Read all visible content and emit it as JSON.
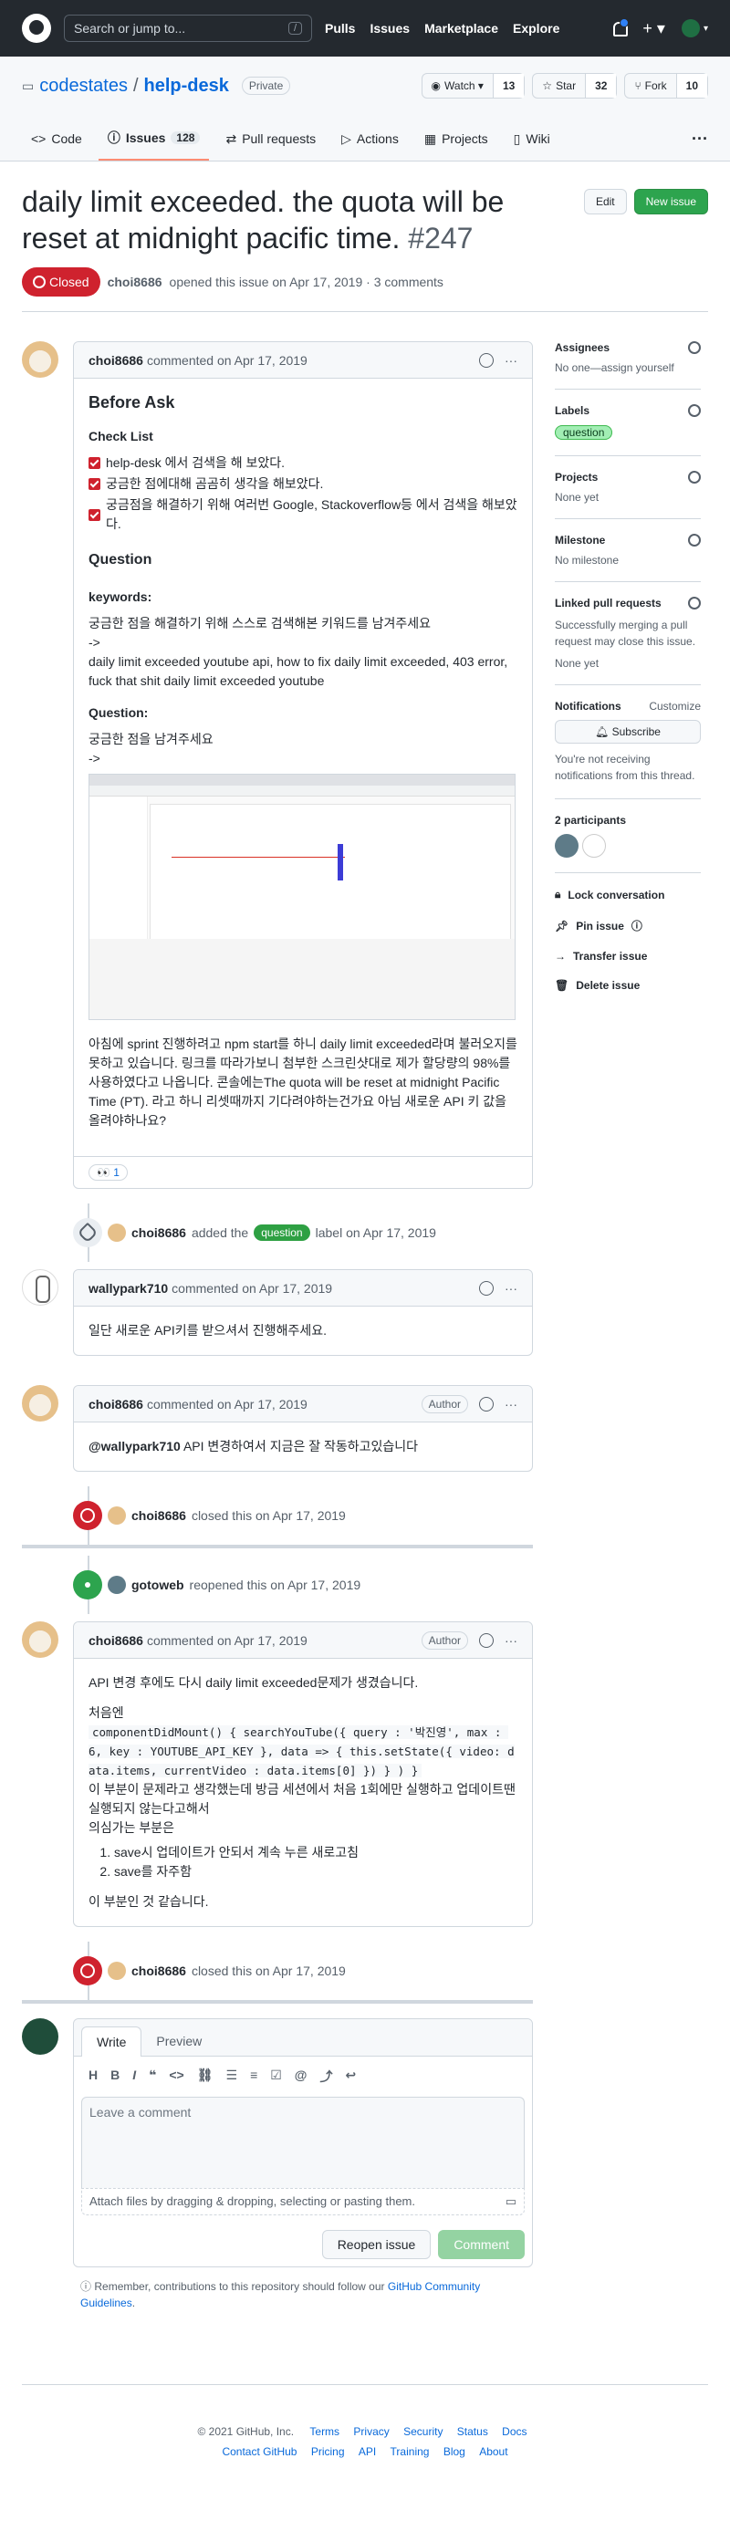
{
  "header": {
    "search_placeholder": "Search or jump to...",
    "search_key": "/",
    "nav": [
      "Pulls",
      "Issues",
      "Marketplace",
      "Explore"
    ]
  },
  "repo": {
    "owner": "codestates",
    "name": "help-desk",
    "visibility": "Private",
    "watch_label": "Watch",
    "watch_count": "13",
    "star_label": "Star",
    "star_count": "32",
    "fork_label": "Fork",
    "fork_count": "10"
  },
  "tabs": [
    {
      "label": "Code"
    },
    {
      "label": "Issues",
      "count": "128"
    },
    {
      "label": "Pull requests"
    },
    {
      "label": "Actions"
    },
    {
      "label": "Projects"
    },
    {
      "label": "Wiki"
    }
  ],
  "issue": {
    "title": "daily limit exceeded. the quota will be reset at midnight pacific time.",
    "number": "#247",
    "edit": "Edit",
    "new_issue": "New issue",
    "state": "Closed",
    "author": "choi8686",
    "meta": "opened this issue on Apr 17, 2019 · 3 comments"
  },
  "c1": {
    "author": "choi8686",
    "meta": "commented on Apr 17, 2019",
    "h_before": "Before Ask",
    "h_check": "Check List",
    "checks": [
      "help-desk 에서 검색을 해 보았다.",
      "궁금한 점에대해 곰곰히 생각을 해보았다.",
      "궁금점을 해결하기 위해 여러번 Google, Stackoverflow등 에서 검색을 해보았다."
    ],
    "h_question": "Question",
    "h_keywords": "keywords:",
    "kw1": "궁금한 점을 해결하기 위해 스스로 검색해본 키워드를 남겨주세요",
    "kw2": "->",
    "kw3": "daily limit exceeded youtube api, how to fix daily limit exceeded, 403 error, fuck that shit daily limit exceeded youtube",
    "h_q2": "Question:",
    "q1": "궁금한 점을 남겨주세요",
    "q2": "->",
    "p_end": "아침에 sprint 진행하려고 npm start를 하니 daily limit exceeded라며 불러오지를 못하고 있습니다. 링크를 따라가보니 첨부한 스크린샷대로 제가 할당량의 98%를 사용하였다고 나옵니다. 콘솔에는The quota will be reset at midnight Pacific Time (PT). 라고 하니 리셋때까지 기다려야하는건가요 아님 새로운 API 키 값을 올려야하나요?",
    "reaction": "👀 1"
  },
  "ev_label": {
    "author": "choi8686",
    "pre": "added the",
    "label": "question",
    "post": "label on Apr 17, 2019"
  },
  "c2": {
    "author": "wallypark710",
    "meta": "commented on Apr 17, 2019",
    "body": "일단 새로운 API키를 받으셔서 진행해주세요."
  },
  "c3": {
    "author": "choi8686",
    "meta": "commented on Apr 17, 2019",
    "badge": "Author",
    "mention": "@wallypark710",
    "body": " API 변경하여서 지금은 잘 작동하고있습니다"
  },
  "ev_close1": {
    "author": "choi8686",
    "text": "closed this on Apr 17, 2019"
  },
  "ev_reopen": {
    "author": "gotoweb",
    "text": "reopened this on Apr 17, 2019"
  },
  "c4": {
    "author": "choi8686",
    "meta": "commented on Apr 17, 2019",
    "badge": "Author",
    "p1": "API 변경 후에도 다시 daily limit exceeded문제가 생겼습니다.",
    "p2": "처음엔",
    "code": "componentDidMount() { searchYouTube({ query : '박진영', max : 6, key : YOUTUBE_API_KEY }, data => { this.setState({ video: data.items, currentVideo : data.items[0] }) } ) }",
    "p3": "이 부분이 문제라고 생각했는데 방금 세션에서 처음 1회에만 실행하고 업데이트땐 실행되지 않는다고해서",
    "p4": "의심가는 부분은",
    "items": [
      "save시 업데이트가 안되서 계속 누른 새로고침",
      "save를 자주함"
    ],
    "p5": "이 부분인 것 같습니다."
  },
  "ev_close2": {
    "author": "choi8686",
    "text": "closed this on Apr 17, 2019"
  },
  "new_comment": {
    "tab_write": "Write",
    "tab_preview": "Preview",
    "placeholder": "Leave a comment",
    "attach": "Attach files by dragging & dropping, selecting or pasting them.",
    "reopen": "Reopen issue",
    "comment": "Comment"
  },
  "guideline": {
    "pre": "Remember, contributions to this repository should follow our ",
    "link": "GitHub Community Guidelines",
    "post": "."
  },
  "sidebar": {
    "assignees": "Assignees",
    "assignees_val": "No one—assign yourself",
    "labels": "Labels",
    "label_val": "question",
    "projects": "Projects",
    "projects_val": "None yet",
    "milestone": "Milestone",
    "milestone_val": "No milestone",
    "linked": "Linked pull requests",
    "linked_desc": "Successfully merging a pull request may close this issue.",
    "linked_val": "None yet",
    "notifications": "Notifications",
    "customize": "Customize",
    "subscribe": "Subscribe",
    "notif_desc": "You're not receiving notifications from this thread.",
    "participants": "2 participants",
    "lock": "Lock conversation",
    "pin": "Pin issue",
    "transfer": "Transfer issue",
    "delete": "Delete issue"
  },
  "footer": {
    "copy": "© 2021 GitHub, Inc.",
    "row1": [
      "Terms",
      "Privacy",
      "Security",
      "Status",
      "Docs"
    ],
    "row2": [
      "Contact GitHub",
      "Pricing",
      "API",
      "Training",
      "Blog",
      "About"
    ]
  }
}
